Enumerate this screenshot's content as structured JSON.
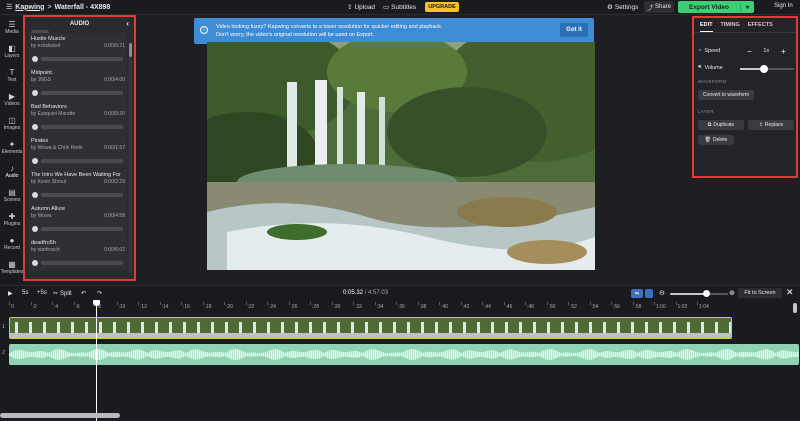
{
  "topbar": {
    "app_link": "Kapwing",
    "separator": ">",
    "project": "Waterfall - 4X898",
    "upload": "Upload",
    "subtitles": "Subtitles",
    "upgrade": "UPGRADE",
    "settings": "Settings",
    "share": "Share",
    "export": "Export Video",
    "signin": "Sign In"
  },
  "rail": [
    {
      "label": "Media",
      "icon": "☰"
    },
    {
      "label": "Layers",
      "icon": "◧"
    },
    {
      "label": "Text",
      "icon": "T"
    },
    {
      "label": "Videos",
      "icon": "▶"
    },
    {
      "label": "Images",
      "icon": "◫"
    },
    {
      "label": "Elements",
      "icon": "✦"
    },
    {
      "label": "Audio",
      "icon": "♪"
    },
    {
      "label": "Scenes",
      "icon": "▤"
    },
    {
      "label": "Plugins",
      "icon": "✚"
    },
    {
      "label": "Record",
      "icon": "●"
    },
    {
      "label": "Templates",
      "icon": "▦"
    }
  ],
  "audio_panel": {
    "title": "AUDIO",
    "tracks": [
      {
        "title": "Hustle Muscle",
        "artist": "by eckskwisit",
        "time": "0:00/5:21"
      },
      {
        "title": "Midpoint.",
        "artist": "by JNGS",
        "time": "0:00/4:00"
      },
      {
        "title": "Bad Behaviors",
        "artist": "by Ezequiel Marotte",
        "time": "0:00/9:20"
      },
      {
        "title": "Pirates",
        "artist": "by Wowa & Chris Rede",
        "time": "0:00/1:57"
      },
      {
        "title": "The Intro We Have Been Waiting For",
        "artist": "by Kevin Shrout",
        "time": "0:00/2:29"
      },
      {
        "title": "Autumn Allure",
        "artist": "by Wowa",
        "time": "0:00/4:58"
      },
      {
        "title": "deadfro5h",
        "artist": "by starfrosch",
        "time": "0:00/6:02"
      }
    ]
  },
  "banner": {
    "line1": "Video looking fuzzy? Kapwing converts to a lower resolution for quicker editing and playback.",
    "line2": "Don't worry, the video's original resolution will be used on Export.",
    "button": "Got it"
  },
  "edit_panel": {
    "tabs": [
      "EDIT",
      "TIMING",
      "EFFECTS"
    ],
    "speed_label": "Speed",
    "speed_value": "1x",
    "volume_label": "Volume",
    "volume_level": 0.45,
    "waveform_section": "WAVEFORM",
    "convert_button": "Convert to waveform",
    "layer_section": "LAYER",
    "duplicate": "Duplicate",
    "replace": "Replace",
    "delete": "Delete"
  },
  "timeline": {
    "back5": "5s",
    "fwd5": "+5s",
    "split": "Split",
    "current_time": "0:05.32",
    "total_time": "4:57.03",
    "fit_button": "Fit to Screen",
    "zoom_level": 0.6,
    "ticks": [
      "0",
      ":2",
      ":4",
      ":6",
      ":8",
      ":10",
      ":12",
      ":14",
      ":16",
      ":18",
      ":20",
      ":22",
      ":24",
      ":26",
      ":28",
      ":30",
      ":32",
      ":34",
      ":36",
      ":38",
      ":40",
      ":42",
      ":44",
      ":46",
      ":48",
      ":50",
      ":52",
      ":54",
      ":56",
      ":58",
      "1:00",
      "1:02",
      "1:04"
    ],
    "track1_label": "1",
    "track2_label": "2"
  },
  "colors": {
    "accent_green": "#3ccf75",
    "upgrade_yellow": "#f7c12a",
    "banner_blue": "#3f8cd6",
    "highlight_red": "#e53935",
    "waveform_teal": "#8fd3b3"
  }
}
